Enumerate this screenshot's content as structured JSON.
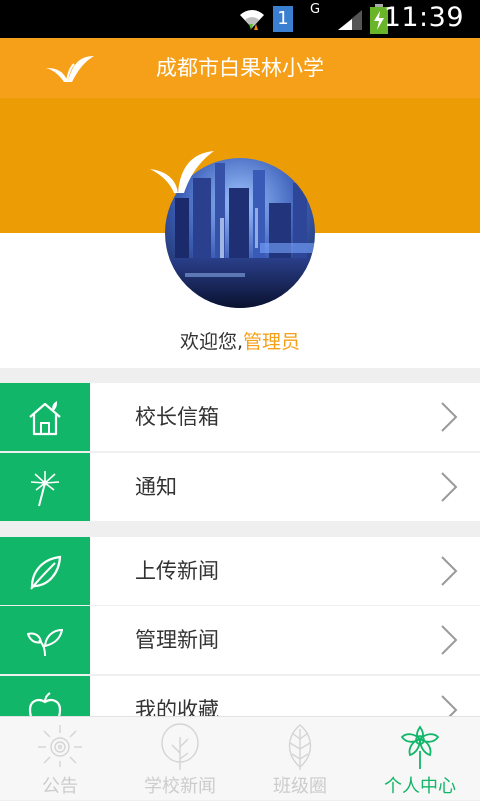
{
  "status_bar": {
    "time": "11:39",
    "sim_badge": "1",
    "network_type": "G"
  },
  "header": {
    "title": "成都市白果林小学"
  },
  "profile": {
    "welcome_prefix": "欢迎您,",
    "user_name": "管理员"
  },
  "menu": {
    "items": [
      {
        "label": "校长信箱",
        "icon": "house-icon"
      },
      {
        "label": "通知",
        "icon": "dandelion-icon"
      },
      {
        "label": "上传新闻",
        "icon": "leaf-icon"
      },
      {
        "label": "管理新闻",
        "icon": "sprout-icon"
      },
      {
        "label": "我的收藏",
        "icon": "apple-icon"
      }
    ]
  },
  "tabs": [
    {
      "label": "公告",
      "icon": "sun-icon",
      "active": false
    },
    {
      "label": "学校新闻",
      "icon": "tree-icon",
      "active": false
    },
    {
      "label": "班级圈",
      "icon": "leaf-outline-icon",
      "active": false
    },
    {
      "label": "个人中心",
      "icon": "flower-icon",
      "active": true
    }
  ],
  "colors": {
    "header": "#f6a01a",
    "banner": "#ec9c05",
    "accent_green": "#12b668",
    "username": "#f6a01a",
    "tab_inactive": "#cccccc"
  }
}
